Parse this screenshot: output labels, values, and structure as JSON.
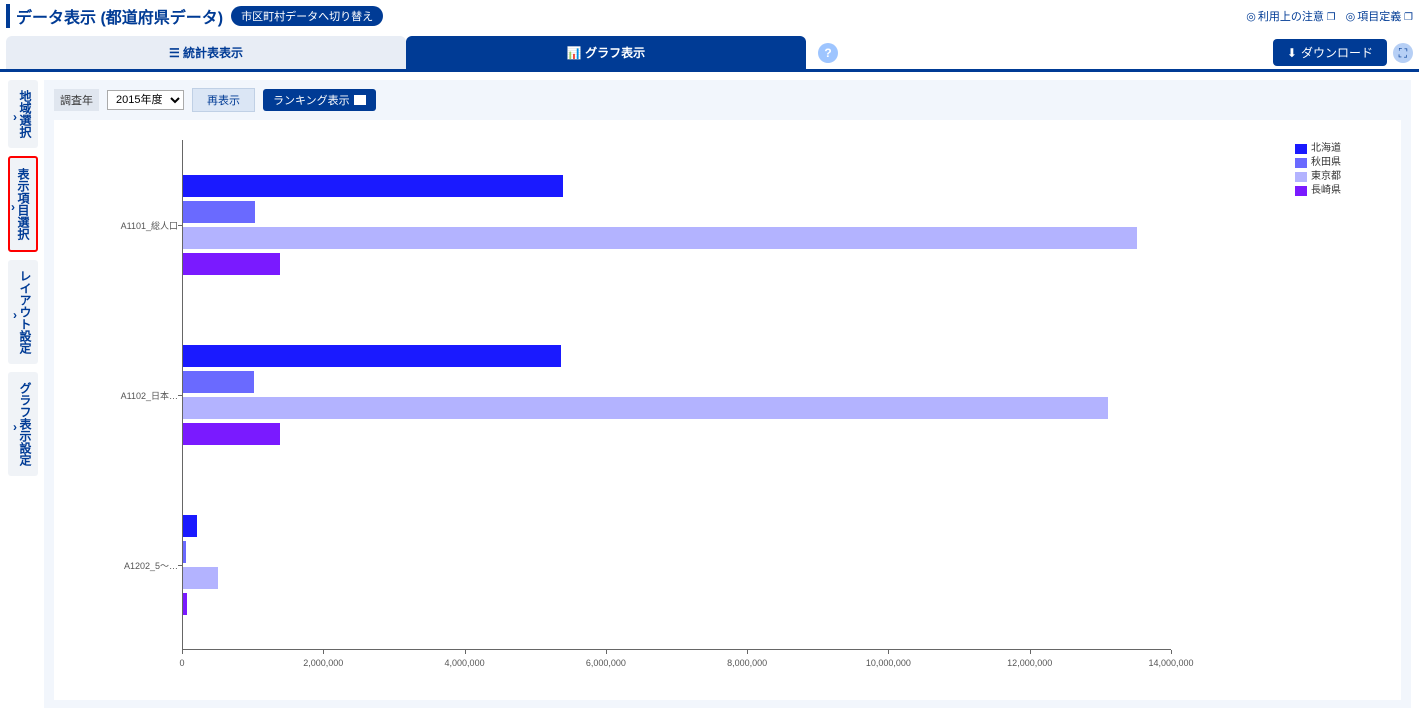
{
  "header": {
    "title": "データ表示 (都道府県データ)",
    "switch_btn": "市区町村データへ切り替え",
    "link_usage": "利用上の注意",
    "link_def": "項目定義"
  },
  "tabs": {
    "table": "統計表表示",
    "graph": "グラフ表示",
    "download": "ダウンロード"
  },
  "sidebar": {
    "region": "地域選択",
    "item": "表示項目選択",
    "layout": "レイアウト設定",
    "graph": "グラフ表示設定"
  },
  "controls": {
    "year_label": "調査年",
    "year_value": "2015年度",
    "reshow": "再表示",
    "ranking": "ランキング表示"
  },
  "legend": [
    "北海道",
    "秋田県",
    "東京都",
    "長崎県"
  ],
  "colors": [
    "#1a1aff",
    "#6a6aff",
    "#b3b3ff",
    "#7a1aff"
  ],
  "chart_data": {
    "type": "bar",
    "orientation": "horizontal",
    "xlim": [
      0,
      14000000
    ],
    "xticks": [
      0,
      2000000,
      4000000,
      6000000,
      8000000,
      10000000,
      12000000,
      14000000
    ],
    "xtick_labels": [
      "0",
      "2,000,000",
      "4,000,000",
      "6,000,000",
      "8,000,000",
      "10,000,000",
      "12,000,000",
      "14,000,000"
    ],
    "categories": [
      "A1101_総人口",
      "A1102_日本…",
      "A1202_5～…"
    ],
    "series": [
      {
        "name": "北海道",
        "color": "#1a1aff",
        "values": [
          5380000,
          5350000,
          200000
        ]
      },
      {
        "name": "秋田県",
        "color": "#6a6aff",
        "values": [
          1020000,
          1010000,
          40000
        ]
      },
      {
        "name": "東京都",
        "color": "#b3b3ff",
        "values": [
          13510000,
          13100000,
          500000
        ]
      },
      {
        "name": "長崎県",
        "color": "#7a1aff",
        "values": [
          1380000,
          1370000,
          60000
        ]
      }
    ]
  }
}
